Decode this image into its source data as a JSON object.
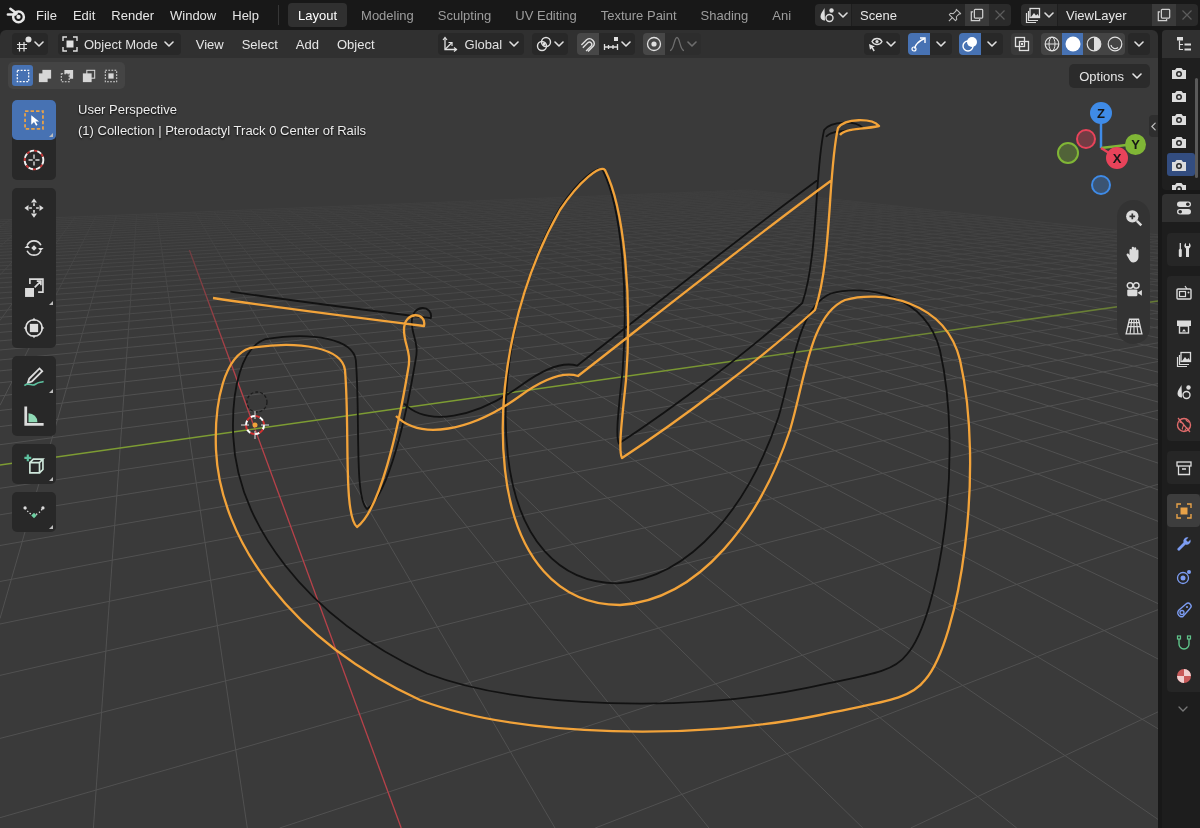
{
  "topbar": {
    "menus": [
      "File",
      "Edit",
      "Render",
      "Window",
      "Help"
    ],
    "workspaces": [
      {
        "label": "Layout",
        "selected": true
      },
      {
        "label": "Modeling",
        "selected": false
      },
      {
        "label": "Sculpting",
        "selected": false
      },
      {
        "label": "UV Editing",
        "selected": false
      },
      {
        "label": "Texture Paint",
        "selected": false
      },
      {
        "label": "Shading",
        "selected": false
      },
      {
        "label": "Ani",
        "selected": false
      }
    ],
    "scene": {
      "value": "Scene"
    },
    "view_layer": {
      "value": "ViewLayer"
    }
  },
  "header": {
    "mode": "Object Mode",
    "menus": [
      "View",
      "Select",
      "Add",
      "Object"
    ],
    "orientation": "Global",
    "snap": {
      "on": false
    },
    "proportional": {
      "on": false
    },
    "falloff": {
      "disabled": true
    },
    "gizmos": {
      "on": true
    },
    "overlays": {
      "on": true
    },
    "xray": {
      "on": false
    },
    "shading": [
      {
        "kind": "wireframe",
        "selected": false
      },
      {
        "kind": "solid",
        "selected": true
      },
      {
        "kind": "material",
        "selected": false
      },
      {
        "kind": "rendered",
        "selected": false
      }
    ]
  },
  "viewport": {
    "select_modes": [
      {
        "kind": "set",
        "selected": true
      },
      {
        "kind": "extend",
        "selected": false
      },
      {
        "kind": "subtract",
        "selected": false
      },
      {
        "kind": "invert",
        "selected": false
      },
      {
        "kind": "intersect",
        "selected": false
      }
    ],
    "tool_groups": [
      {
        "tools": [
          {
            "kind": "select_box",
            "selected": true,
            "has_variants": true
          },
          {
            "kind": "cursor",
            "selected": false,
            "has_variants": false
          }
        ]
      },
      {
        "tools": [
          {
            "kind": "move",
            "selected": false,
            "has_variants": false
          },
          {
            "kind": "rotate",
            "selected": false,
            "has_variants": false
          },
          {
            "kind": "scale",
            "selected": false,
            "has_variants": true
          },
          {
            "kind": "transform",
            "selected": false,
            "has_variants": false
          }
        ]
      },
      {
        "tools": [
          {
            "kind": "annotate",
            "selected": false,
            "has_variants": true
          },
          {
            "kind": "measure",
            "selected": false,
            "has_variants": false
          }
        ]
      },
      {
        "tools": [
          {
            "kind": "add_cube",
            "selected": false,
            "has_variants": true
          }
        ]
      },
      {
        "tools": [
          {
            "kind": "curve_draw",
            "selected": false,
            "has_variants": true
          }
        ]
      }
    ],
    "info": [
      "User Perspective",
      "(1) Collection | Pterodactyl Track 0 Center of Rails"
    ],
    "options": "Options",
    "gizmo_axes": [
      {
        "label": "Z",
        "color": "#3f8be7"
      },
      {
        "label": "Y",
        "color": "#80b636"
      },
      {
        "label": "X",
        "color": "#e8435a"
      }
    ],
    "curves": [
      {
        "selected": true
      },
      {
        "selected": false
      }
    ]
  },
  "outliner": {
    "rows": [
      {
        "selected": false
      },
      {
        "selected": false
      },
      {
        "selected": false
      },
      {
        "selected": false
      },
      {
        "selected": true
      },
      {
        "selected": false
      }
    ]
  },
  "properties": {
    "tab_groups": [
      {
        "tabs": [
          {
            "kind": "tool",
            "selected": false
          }
        ]
      },
      {
        "tabs": [
          {
            "kind": "render",
            "selected": false
          },
          {
            "kind": "output",
            "selected": false
          },
          {
            "kind": "view_layer",
            "selected": false
          },
          {
            "kind": "scene",
            "selected": false
          },
          {
            "kind": "world",
            "selected": false
          }
        ]
      },
      {
        "tabs": [
          {
            "kind": "collection",
            "selected": false
          }
        ]
      },
      {
        "tabs": [
          {
            "kind": "object",
            "selected": true
          },
          {
            "kind": "modifiers",
            "selected": false
          },
          {
            "kind": "particles",
            "selected": false
          },
          {
            "kind": "physics",
            "selected": false
          },
          {
            "kind": "data",
            "selected": false
          },
          {
            "kind": "material",
            "selected": false
          }
        ]
      }
    ]
  }
}
